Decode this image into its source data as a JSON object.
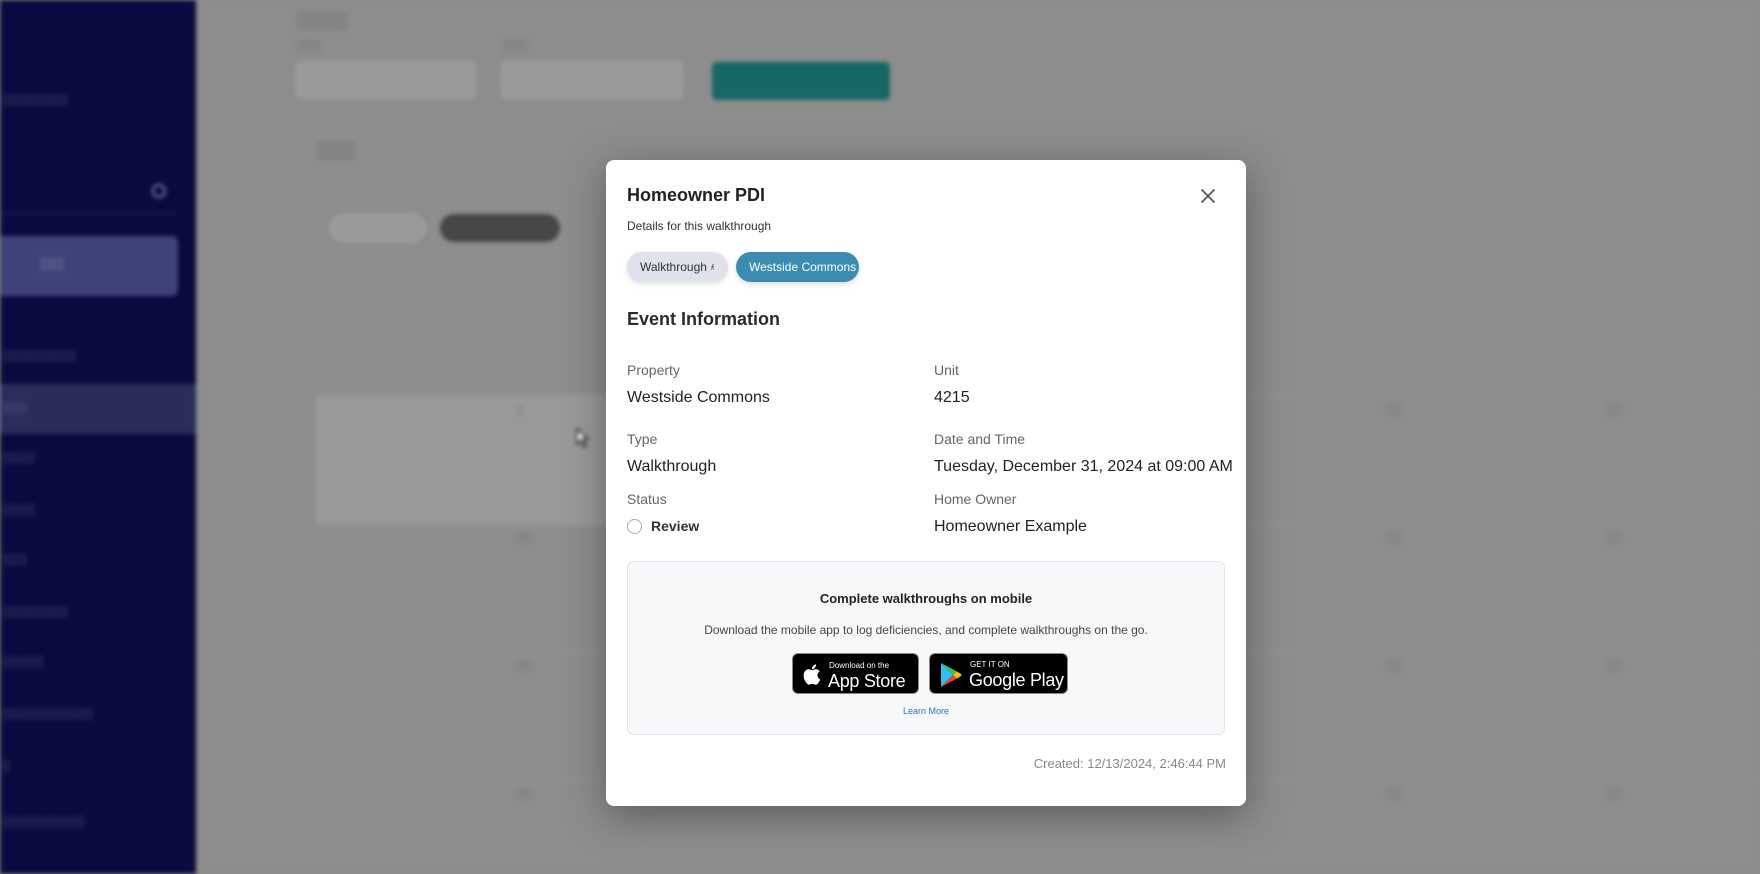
{
  "modal": {
    "title": "Homeowner PDI",
    "subtitle": "Details for this walkthrough",
    "chips": {
      "type_label": "Walkthrough",
      "type_icon": "walking-person-icon",
      "property_label": "Westside Commons",
      "property_color": "#3a8db0"
    },
    "section_title": "Event Information",
    "fields": {
      "property": {
        "label": "Property",
        "value": "Westside Commons"
      },
      "unit": {
        "label": "Unit",
        "value": "4215"
      },
      "type": {
        "label": "Type",
        "value": "Walkthrough"
      },
      "date_time": {
        "label": "Date and Time",
        "value": "Tuesday, December 31, 2024 at 09:00 AM"
      },
      "status": {
        "label": "Status",
        "value": "Review"
      },
      "home_owner": {
        "label": "Home Owner",
        "value": "Homeowner Example"
      }
    },
    "mobile_promo": {
      "title": "Complete walkthroughs on mobile",
      "description": "Download the mobile app to log deficiencies, and complete walkthroughs on the go.",
      "app_store": {
        "small": "Download on the",
        "big": "App Store"
      },
      "google_play": {
        "small": "GET IT ON",
        "big": "Google Play"
      },
      "learn_more": "Learn More"
    },
    "created": "Created: 12/13/2024, 2:46:44 PM",
    "close_icon": "close-icon"
  }
}
